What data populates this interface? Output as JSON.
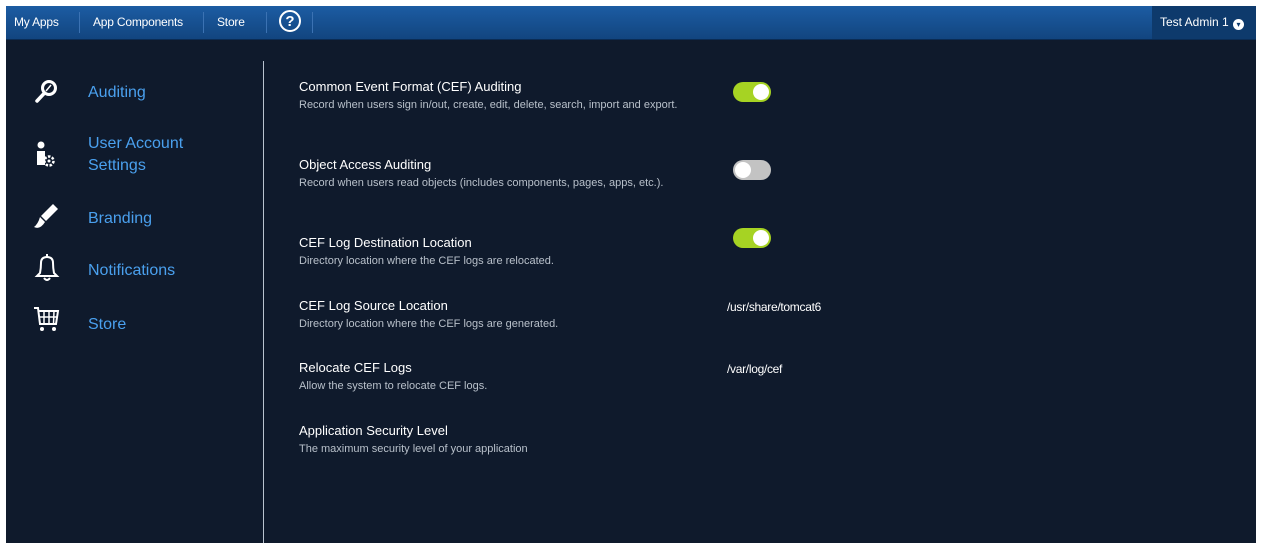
{
  "topbar": {
    "nav": [
      "My Apps",
      "App Components",
      "Store"
    ],
    "help_label": "?",
    "user_label": "Test Admin 1",
    "user_caret": "▾"
  },
  "sidebar": {
    "items": [
      {
        "label": "Auditing",
        "icon": "search-icon"
      },
      {
        "label": "User Account Settings",
        "icon": "user-settings-icon"
      },
      {
        "label": "Branding",
        "icon": "paintbrush-icon"
      },
      {
        "label": "Notifications",
        "icon": "bell-icon"
      },
      {
        "label": "Store",
        "icon": "cart-icon"
      }
    ]
  },
  "settings": [
    {
      "title": "Common Event Format (CEF) Auditing",
      "desc": "Record when users sign in/out, create, edit, delete, search, import and export.",
      "control": "toggle",
      "checked": true
    },
    {
      "title": "Object Access Auditing",
      "desc": "Record when users read objects (includes components, pages, apps, etc.).",
      "control": "toggle",
      "checked": false
    },
    {
      "title": "CEF Log Destination Location",
      "desc": "Directory location where the CEF logs are relocated.",
      "control": "toggle",
      "checked": true
    },
    {
      "title": "CEF Log Source Location",
      "desc": "Directory location where the CEF logs are generated.",
      "control": "text",
      "value": "/usr/share/tomcat6"
    },
    {
      "title": "Relocate CEF Logs",
      "desc": "Allow the system to relocate CEF logs.",
      "control": "text",
      "value": "/var/log/cef"
    },
    {
      "title": "Application Security Level",
      "desc": "The maximum security level of your application",
      "control": "none"
    }
  ],
  "colors": {
    "background": "#0f1a2c",
    "topbar": "#1a559a",
    "accent_link": "#4aa0ee",
    "toggle_on": "#a6d323",
    "toggle_off": "#c3c3c3"
  }
}
